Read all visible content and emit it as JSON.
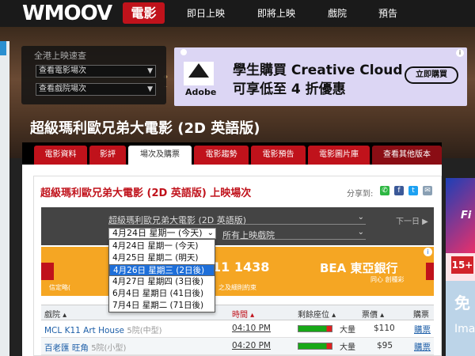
{
  "header": {
    "logo": "WMOOV",
    "logo_sub": "電影",
    "nav": [
      "即日上映",
      "即將上映",
      "戲院",
      "預告"
    ]
  },
  "search": {
    "title": "全港上映速查",
    "movie_select": "查看電影場次",
    "cinema_select": "查看戲院場次"
  },
  "ad": {
    "brand": "Adobe",
    "line1": "學生購買 Creative Cloud",
    "line2": "可享低至 4 折優惠",
    "button": "立即購買"
  },
  "movie": {
    "title": "超級瑪利歐兄弟大電影 (2D 英語版)"
  },
  "tabs": [
    "電影資料",
    "影評",
    "場次及購票",
    "電影趨勢",
    "電影預告",
    "電影圖片庫",
    "查看其他版本"
  ],
  "showtimes": {
    "title": "超級瑪利歐兄弟大電影 (2D 英語版) 上映場次",
    "share_label": "分享到:",
    "film_select": "超級瑪利歐兄弟大電影 (2D 英語版)",
    "next_label": "下一日 ▶",
    "date_select": "4月24日 星期一 (今天)",
    "cinema_select": "所有上映戲院",
    "date_options": [
      "4月24日 星期一 (今天)",
      "4月25日 星期二 (明天)",
      "4月26日 星期三 (2日後)",
      "4月27日 星期四 (3日後)",
      "6月4日 星期日 (41日後)",
      "7月4日 星期二 (71日後)"
    ],
    "selected_option_index": 2
  },
  "bea_ad": {
    "number": "11 1438",
    "brand": "BEA 東亞銀行",
    "tagline": "同心 創種彩",
    "note_left": "信定略(",
    "note_right": "之及細則約束"
  },
  "table": {
    "headers": [
      "戲院 ▴",
      "時間 ▴",
      "剩餘座位 ▴",
      "票價 ▴",
      "購票"
    ],
    "rows": [
      {
        "cinema": "MCL K11 Art House",
        "hall": "5院(中型)",
        "time": "04:10 PM",
        "seats": "大量",
        "price": "$110",
        "buy": "購票"
      },
      {
        "cinema": "百老匯 旺角",
        "hall": "5院(小型)",
        "time": "04:20 PM",
        "seats": "大量",
        "price": "$95",
        "buy": "購票"
      }
    ]
  },
  "right_ad": {
    "brand": "Fi",
    "rating": "15+",
    "text": "免",
    "text2": "Ima"
  },
  "colors": {
    "brand_red": "#c0121b",
    "link_blue": "#1e5fa8",
    "selected_blue": "#1e6fd9"
  }
}
